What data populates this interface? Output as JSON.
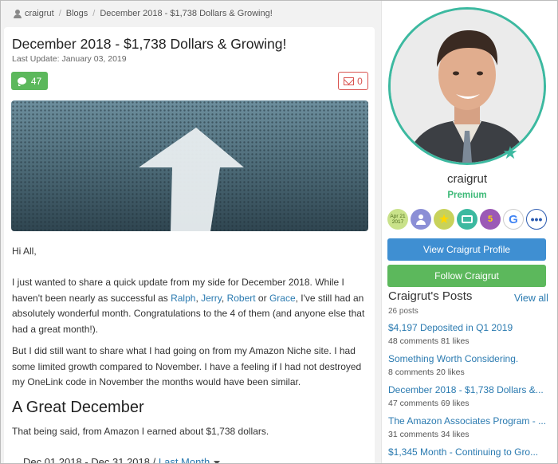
{
  "breadcrumb": {
    "user": "craigrut",
    "section": "Blogs",
    "current": "December 2018 - $1,738 Dollars & Growing!"
  },
  "post": {
    "title": "December 2018 - $1,738 Dollars & Growing!",
    "last_update": "Last Update: January 03, 2019",
    "comment_count": "47",
    "mail_count": "0",
    "greeting": "Hi All,",
    "p2_before": "I just wanted to share a quick update from my side for December 2018. While I haven't been nearly as successful as ",
    "link_ralph": "Ralph",
    "link_jerry": "Jerry",
    "link_robert": "Robert",
    "link_grace": "Grace",
    "word_or": " or ",
    "p2_after": ", I've still had an absolutely wonderful month. Congratulations to the 4 of them (and anyone else that had a great month!).",
    "p3": "But I did still want to share what I had going on from my Amazon Niche site. I had some limited growth compared to November. I have a feeling if I had not destroyed my OneLink code in November the months would have been similar.",
    "section_heading": "A Great December",
    "p4": "That being said, from Amazon I earned about $1,738 dollars.",
    "date_range": "Dec 01 2018 - Dec 31 2018 /",
    "range_link": "Last Month"
  },
  "sidebar": {
    "username": "craigrut",
    "membership": "Premium",
    "badge1_line1": "Apr 21",
    "badge1_line2": "2017",
    "badge5_label": "5",
    "badge6_label": "G",
    "badge7_label": "•••",
    "view_profile_label": "View Craigrut Profile",
    "follow_label": "Follow Craigrut",
    "posts_heading": "Craigrut's Posts",
    "view_all": "View all",
    "posts_count": "26 posts",
    "posts": [
      {
        "title": "$4,197 Deposited in Q1 2019",
        "meta": "48 comments   81 likes"
      },
      {
        "title": "Something Worth Considering.",
        "meta": "8 comments   20 likes"
      },
      {
        "title": "December 2018 - $1,738 Dollars &...",
        "meta": "47 comments   69 likes"
      },
      {
        "title": "The Amazon Associates Program - ...",
        "meta": "31 comments   34 likes"
      },
      {
        "title": "$1,345 Month - Continuing to Gro...",
        "meta": ""
      }
    ]
  },
  "colors": {
    "accent_teal": "#3cb9a0",
    "link_blue": "#2a7ab0",
    "green": "#5cb85c",
    "blue_button": "#3f8fd2",
    "red": "#d9534f"
  }
}
